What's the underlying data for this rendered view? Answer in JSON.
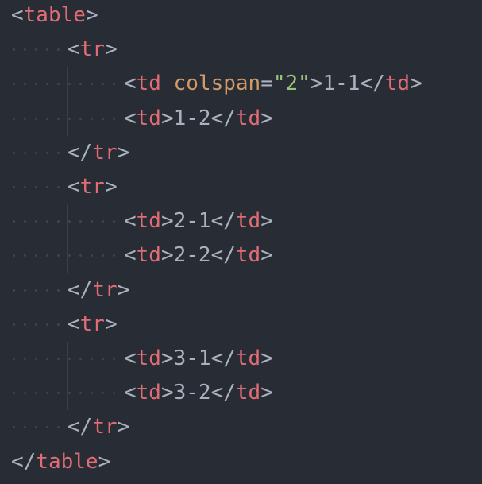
{
  "editor": {
    "language": "html",
    "theme_colors": {
      "background": "#282c34",
      "tag": "#e06c75",
      "attribute": "#d19a66",
      "string": "#98c379",
      "text": "#abb2bf",
      "punctuation": "#abb2bf",
      "indent_guide": "#3b4048",
      "whitespace_dot": "#3e4451"
    },
    "lines": [
      {
        "indent": 0,
        "tokens": [
          {
            "t": "punc",
            "v": "<"
          },
          {
            "t": "tag",
            "v": "table"
          },
          {
            "t": "punc",
            "v": ">"
          }
        ]
      },
      {
        "indent": 1,
        "tokens": [
          {
            "t": "punc",
            "v": "<"
          },
          {
            "t": "tag",
            "v": "tr"
          },
          {
            "t": "punc",
            "v": ">"
          }
        ]
      },
      {
        "indent": 2,
        "tokens": [
          {
            "t": "punc",
            "v": "<"
          },
          {
            "t": "tag",
            "v": "td"
          },
          {
            "t": "txt",
            "v": " "
          },
          {
            "t": "attr",
            "v": "colspan"
          },
          {
            "t": "punc",
            "v": "="
          },
          {
            "t": "str",
            "v": "\"2\""
          },
          {
            "t": "punc",
            "v": ">"
          },
          {
            "t": "txt",
            "v": "1-1"
          },
          {
            "t": "punc",
            "v": "</"
          },
          {
            "t": "tag",
            "v": "td"
          },
          {
            "t": "punc",
            "v": ">"
          }
        ]
      },
      {
        "indent": 2,
        "tokens": [
          {
            "t": "punc",
            "v": "<"
          },
          {
            "t": "tag",
            "v": "td"
          },
          {
            "t": "punc",
            "v": ">"
          },
          {
            "t": "txt",
            "v": "1-2"
          },
          {
            "t": "punc",
            "v": "</"
          },
          {
            "t": "tag",
            "v": "td"
          },
          {
            "t": "punc",
            "v": ">"
          }
        ]
      },
      {
        "indent": 1,
        "tokens": [
          {
            "t": "punc",
            "v": "</"
          },
          {
            "t": "tag",
            "v": "tr"
          },
          {
            "t": "punc",
            "v": ">"
          }
        ]
      },
      {
        "indent": 1,
        "tokens": [
          {
            "t": "punc",
            "v": "<"
          },
          {
            "t": "tag",
            "v": "tr"
          },
          {
            "t": "punc",
            "v": ">"
          }
        ]
      },
      {
        "indent": 2,
        "tokens": [
          {
            "t": "punc",
            "v": "<"
          },
          {
            "t": "tag",
            "v": "td"
          },
          {
            "t": "punc",
            "v": ">"
          },
          {
            "t": "txt",
            "v": "2-1"
          },
          {
            "t": "punc",
            "v": "</"
          },
          {
            "t": "tag",
            "v": "td"
          },
          {
            "t": "punc",
            "v": ">"
          }
        ]
      },
      {
        "indent": 2,
        "tokens": [
          {
            "t": "punc",
            "v": "<"
          },
          {
            "t": "tag",
            "v": "td"
          },
          {
            "t": "punc",
            "v": ">"
          },
          {
            "t": "txt",
            "v": "2-2"
          },
          {
            "t": "punc",
            "v": "</"
          },
          {
            "t": "tag",
            "v": "td"
          },
          {
            "t": "punc",
            "v": ">"
          }
        ]
      },
      {
        "indent": 1,
        "tokens": [
          {
            "t": "punc",
            "v": "</"
          },
          {
            "t": "tag",
            "v": "tr"
          },
          {
            "t": "punc",
            "v": ">"
          }
        ]
      },
      {
        "indent": 1,
        "tokens": [
          {
            "t": "punc",
            "v": "<"
          },
          {
            "t": "tag",
            "v": "tr"
          },
          {
            "t": "punc",
            "v": ">"
          }
        ]
      },
      {
        "indent": 2,
        "tokens": [
          {
            "t": "punc",
            "v": "<"
          },
          {
            "t": "tag",
            "v": "td"
          },
          {
            "t": "punc",
            "v": ">"
          },
          {
            "t": "txt",
            "v": "3-1"
          },
          {
            "t": "punc",
            "v": "</"
          },
          {
            "t": "tag",
            "v": "td"
          },
          {
            "t": "punc",
            "v": ">"
          }
        ]
      },
      {
        "indent": 2,
        "tokens": [
          {
            "t": "punc",
            "v": "<"
          },
          {
            "t": "tag",
            "v": "td"
          },
          {
            "t": "punc",
            "v": ">"
          },
          {
            "t": "txt",
            "v": "3-2"
          },
          {
            "t": "punc",
            "v": "</"
          },
          {
            "t": "tag",
            "v": "td"
          },
          {
            "t": "punc",
            "v": ">"
          }
        ]
      },
      {
        "indent": 1,
        "tokens": [
          {
            "t": "punc",
            "v": "</"
          },
          {
            "t": "tag",
            "v": "tr"
          },
          {
            "t": "punc",
            "v": ">"
          }
        ]
      },
      {
        "indent": 0,
        "tokens": [
          {
            "t": "punc",
            "v": "</"
          },
          {
            "t": "tag",
            "v": "table"
          },
          {
            "t": "punc",
            "v": ">"
          }
        ]
      }
    ]
  }
}
